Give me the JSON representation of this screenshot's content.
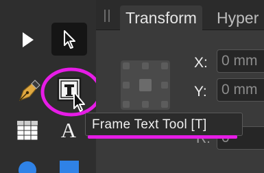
{
  "panel": {
    "tabs": [
      {
        "label": "Transform",
        "active": true
      },
      {
        "label": "Hyper",
        "active": false
      }
    ],
    "fields": [
      {
        "label": "X:",
        "value": "0 mm"
      },
      {
        "label": "Y:",
        "value": "0 mm"
      },
      {
        "label": "R:",
        "value": "0 °"
      }
    ]
  },
  "tools": [
    {
      "icon": "move-tool-icon",
      "selected": false
    },
    {
      "icon": "node-tool-icon",
      "selected": true
    },
    {
      "icon": "pen-tool-icon",
      "selected": false
    },
    {
      "icon": "frame-text-tool-icon",
      "selected": false,
      "highlighted": true
    },
    {
      "icon": "table-tool-icon",
      "selected": false
    },
    {
      "icon": "artistic-text-tool-icon",
      "selected": false,
      "glyph": "A"
    },
    {
      "icon": "ellipse-tool-icon",
      "selected": false
    },
    {
      "icon": "rectangle-tool-icon",
      "selected": false
    }
  ],
  "tooltip": {
    "text": "Frame Text Tool [T]"
  },
  "colors": {
    "highlight": "#e61ce6",
    "accent": "#2f82e6"
  }
}
